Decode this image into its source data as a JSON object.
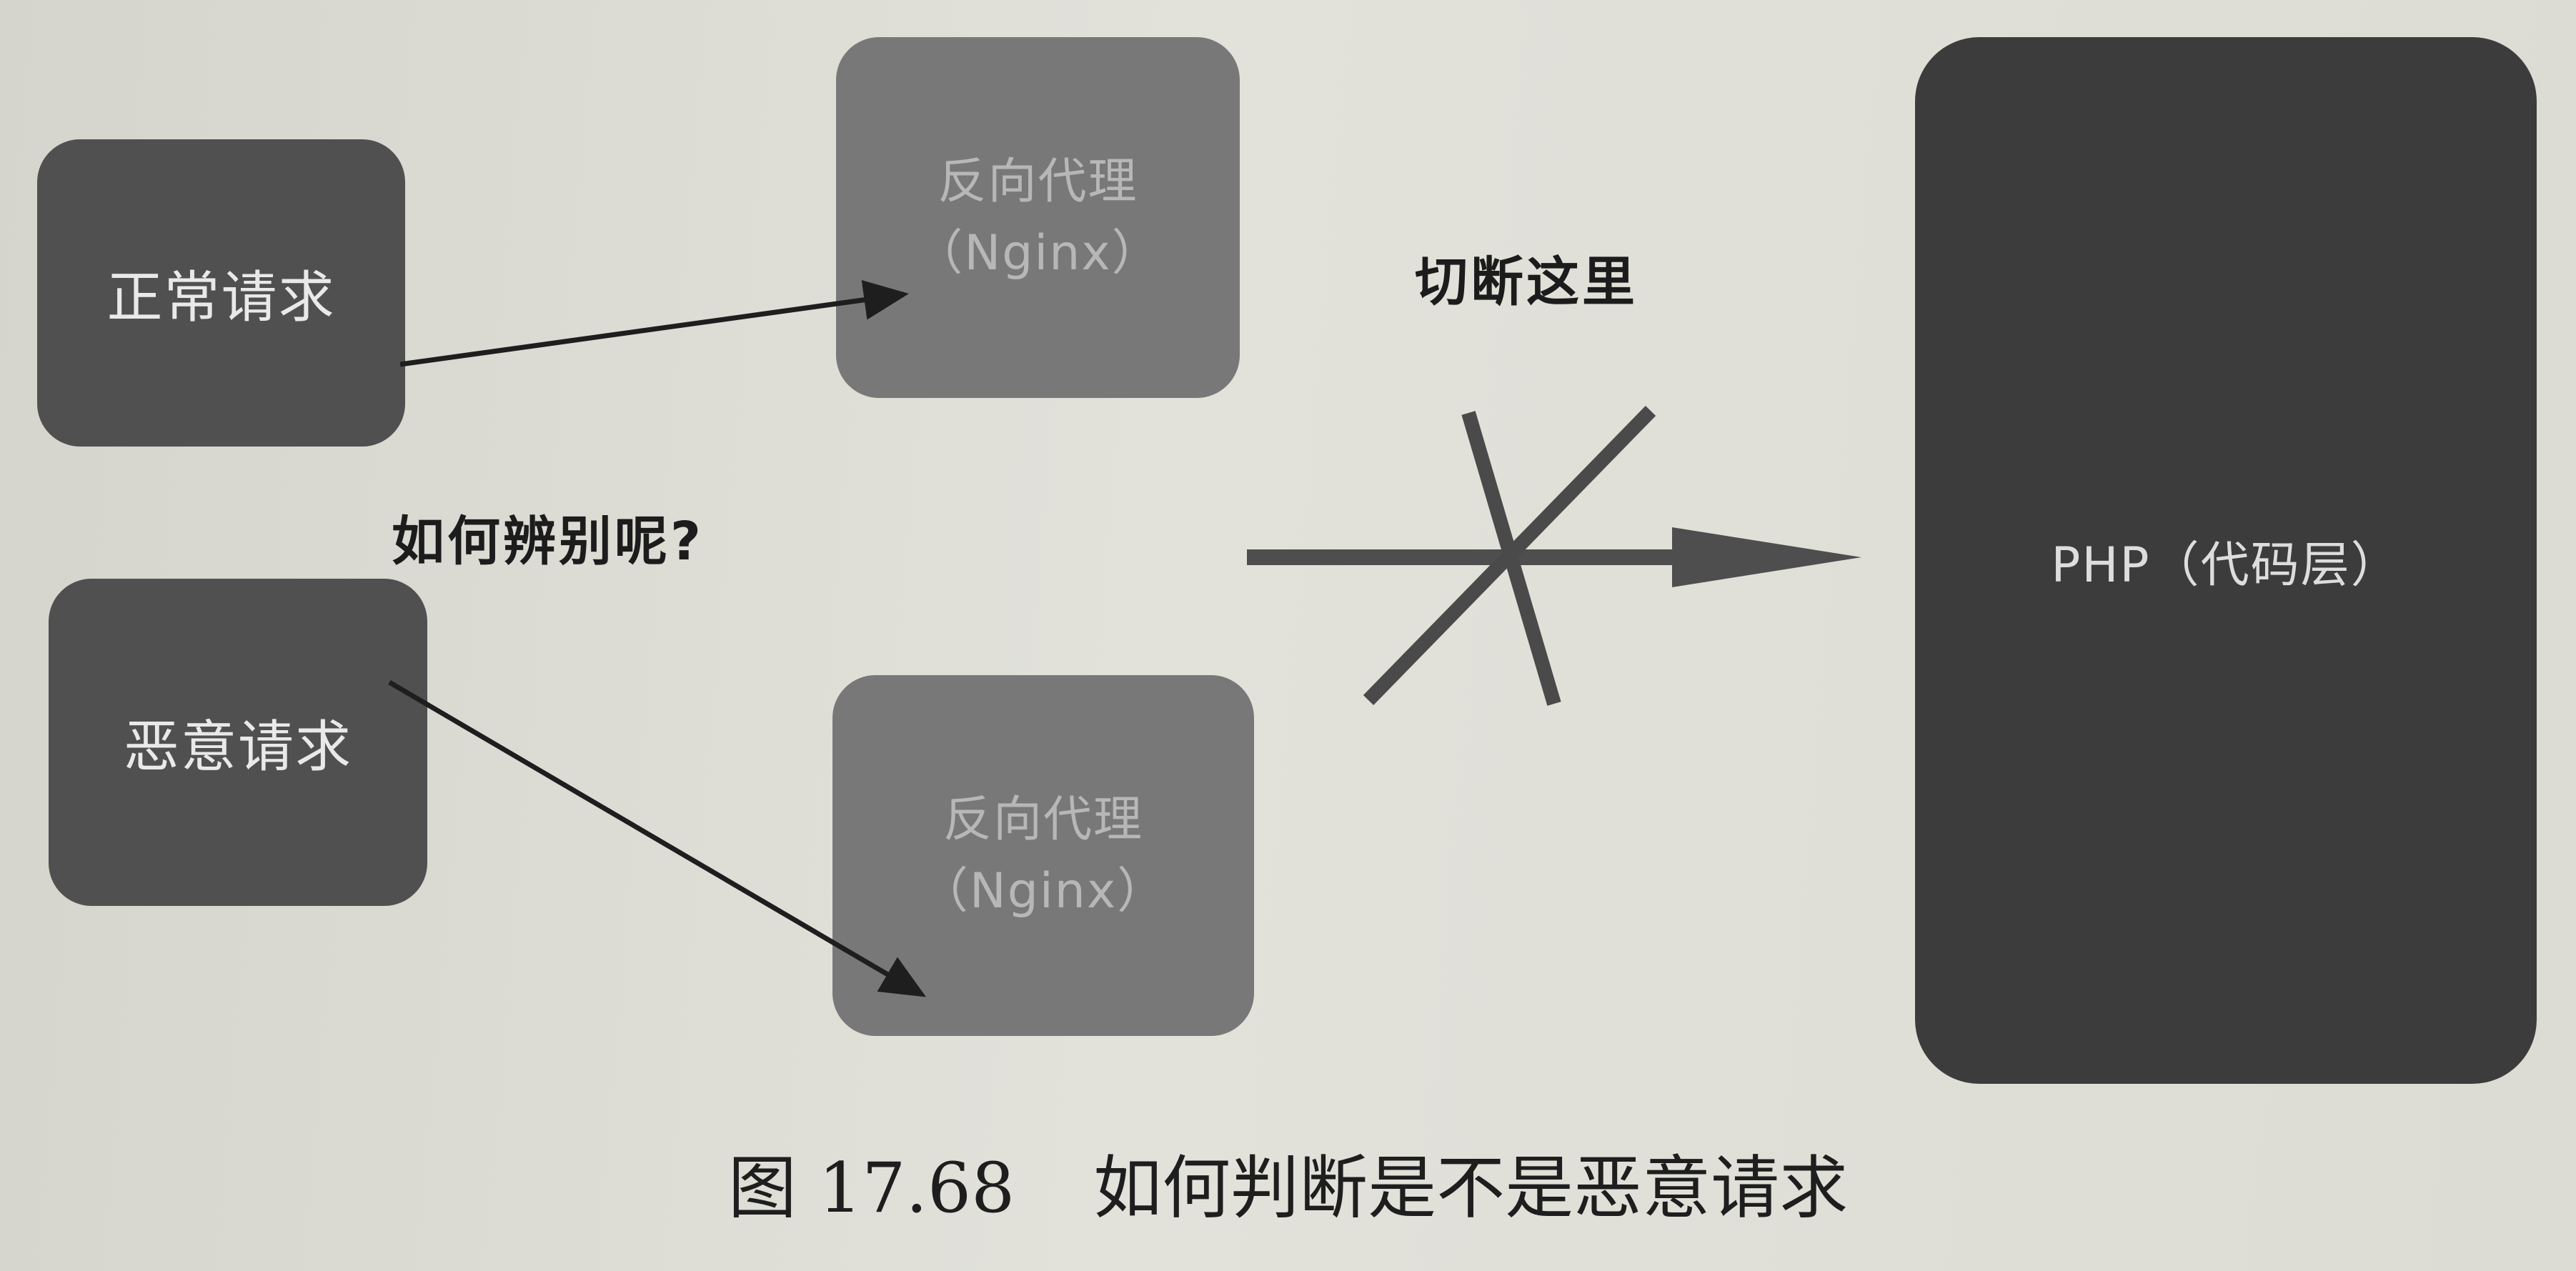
{
  "normal_request": {
    "label": "正常请求"
  },
  "malicious_request": {
    "label": "恶意请求"
  },
  "proxy_top": {
    "line1": "反向代理",
    "line2": "（Nginx）"
  },
  "proxy_bottom": {
    "line1": "反向代理",
    "line2": "（Nginx）"
  },
  "backend": {
    "label": "PHP（代码层）"
  },
  "question_label": "如何辨别呢?",
  "cut_label": "切断这里",
  "caption": {
    "figure_number": "图 17.68",
    "title": "如何判断是不是恶意请求"
  },
  "colors": {
    "request_box": "#505050",
    "proxy_box": "#787878",
    "backend_box": "#3c3c3c",
    "arrow": "#1e1e1e",
    "cut_marks": "#4a4a4a"
  },
  "icons": [
    "arrow-right-icon",
    "cross-icon"
  ]
}
